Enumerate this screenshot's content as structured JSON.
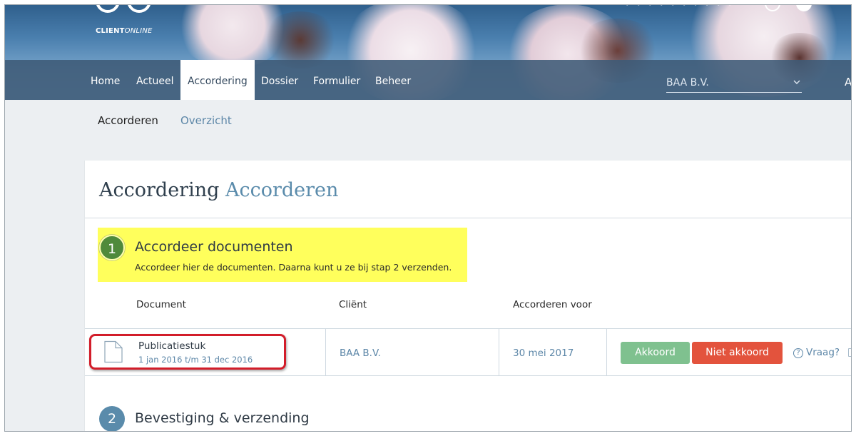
{
  "header": {
    "logo": {
      "brand": "CLIENT",
      "brand_suffix": "ONLINE"
    },
    "top_right_text": "• • • • • • • • • •"
  },
  "nav": {
    "items": [
      {
        "label": "Home"
      },
      {
        "label": "Actueel"
      },
      {
        "label": "Accordering",
        "active": true
      },
      {
        "label": "Dossier"
      },
      {
        "label": "Formulier"
      },
      {
        "label": "Beheer"
      }
    ],
    "client_select": {
      "value": "BAA B.V."
    },
    "edge_text": "A"
  },
  "subnav": {
    "items": [
      {
        "label": "Accorderen",
        "active": true
      },
      {
        "label": "Overzicht"
      }
    ]
  },
  "page": {
    "title_main": "Accordering",
    "title_accent": "Accorderen"
  },
  "step1": {
    "number": "1",
    "title": "Accordeer documenten",
    "subtitle": "Accordeer hier de documenten. Daarna kunt u ze bij stap 2 verzenden."
  },
  "table": {
    "columns": [
      "Document",
      "Cliënt",
      "Accorderen voor"
    ],
    "rows": [
      {
        "document": "Publicatiestuk",
        "period": "1 jan 2016 t/m 31 dec 2016",
        "client": "BAA B.V.",
        "deadline": "30 mei 2017",
        "approve_label": "Akkoord",
        "reject_label": "Niet akkoord",
        "question_label": "Vraag?"
      }
    ]
  },
  "step2": {
    "number": "2",
    "title": "Bevestiging & verzending"
  },
  "colors": {
    "nav_bg": "#3e5a76",
    "accent_blue": "#5a8bab",
    "approve_green": "#7fc18f",
    "reject_red": "#e3533d",
    "highlight_yellow": "#ffff5c",
    "step1_green": "#4f8a3b",
    "annotation_red": "#d21d2a"
  }
}
